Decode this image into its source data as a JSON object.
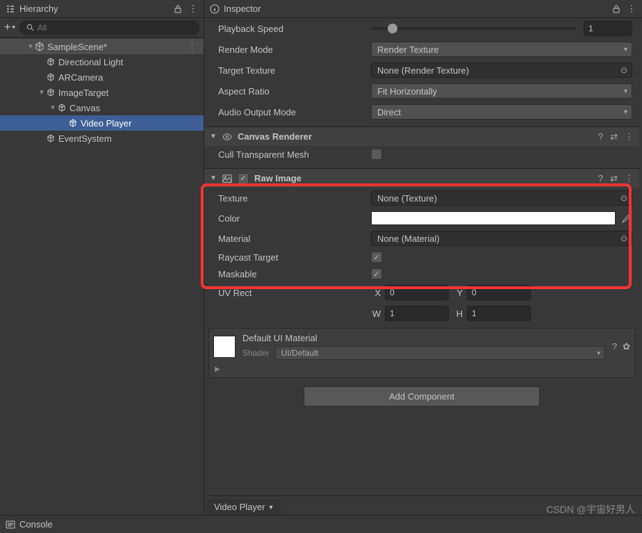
{
  "hierarchy": {
    "title": "Hierarchy",
    "search_placeholder": "All",
    "scene": {
      "name": "SampleScene*"
    },
    "items": [
      {
        "name": "Directional Light"
      },
      {
        "name": "ARCamera"
      },
      {
        "name": "ImageTarget"
      },
      {
        "name": "Canvas"
      },
      {
        "name": "Video Player"
      },
      {
        "name": "EventSystem"
      }
    ]
  },
  "inspector": {
    "title": "Inspector",
    "playback_speed": {
      "label": "Playback Speed",
      "value": "1"
    },
    "render_mode": {
      "label": "Render Mode",
      "value": "Render Texture"
    },
    "target_texture": {
      "label": "Target Texture",
      "value": "None (Render Texture)"
    },
    "aspect_ratio": {
      "label": "Aspect Ratio",
      "value": "Fit Horizontally"
    },
    "audio_output": {
      "label": "Audio Output Mode",
      "value": "Direct"
    },
    "canvas_renderer": {
      "title": "Canvas Renderer",
      "cull": {
        "label": "Cull Transparent Mesh"
      }
    },
    "raw_image": {
      "title": "Raw Image",
      "texture": {
        "label": "Texture",
        "value": "None (Texture)"
      },
      "color": {
        "label": "Color",
        "value": "#FFFFFF"
      },
      "material": {
        "label": "Material",
        "value": "None (Material)"
      },
      "raycast": {
        "label": "Raycast Target"
      },
      "maskable": {
        "label": "Maskable"
      },
      "uv_rect": {
        "label": "UV Rect",
        "x": "0",
        "y": "0",
        "w": "1",
        "h": "1"
      }
    },
    "default_material": {
      "title": "Default UI Material",
      "shader_label": "Shader",
      "shader_value": "UI/Default"
    },
    "add_component": "Add Component",
    "bottom_tab": "Video Player"
  },
  "console": {
    "title": "Console"
  },
  "watermark": "CSDN @宇宙好男人"
}
